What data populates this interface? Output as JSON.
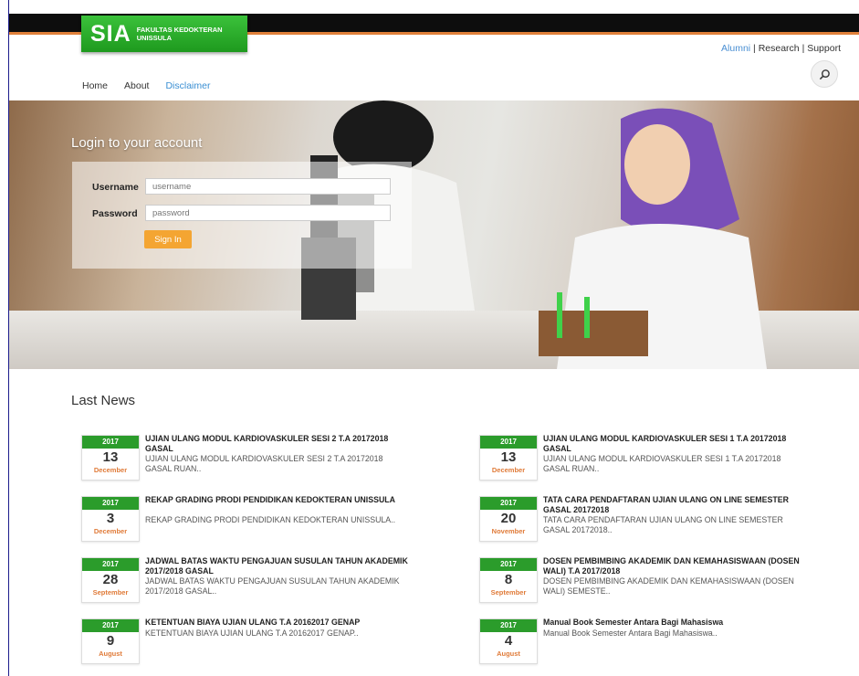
{
  "logo": {
    "main": "SIA",
    "sub_line1": "FAKULTAS KEDOKTERAN",
    "sub_line2": "UNISSULA"
  },
  "toplinks": {
    "alumni": "Alumni",
    "sep1": " | ",
    "research": "Research",
    "sep2": " | ",
    "support": "Support"
  },
  "nav": {
    "home": "Home",
    "about": "About",
    "disclaimer": "Disclaimer"
  },
  "login": {
    "title": "Login to your account",
    "username_label": "Username",
    "username_placeholder": "username",
    "password_label": "Password",
    "password_placeholder": "password",
    "signin_label": "Sign In"
  },
  "news": {
    "section_title": "Last News",
    "items": [
      {
        "year": "2017",
        "day": "13",
        "month": "December",
        "title": "UJIAN ULANG MODUL KARDIOVASKULER SESI 2 T.A 20172018 GASAL",
        "excerpt": "UJIAN ULANG MODUL KARDIOVASKULER SESI 2 T.A 20172018 GASAL RUAN.."
      },
      {
        "year": "2017",
        "day": "13",
        "month": "December",
        "title": "UJIAN ULANG MODUL KARDIOVASKULER SESI 1 T.A 20172018 GASAL",
        "excerpt": "UJIAN ULANG MODUL KARDIOVASKULER SESI 1 T.A 20172018 GASAL RUAN.."
      },
      {
        "year": "2017",
        "day": "3",
        "month": "December",
        "title": "REKAP GRADING PRODI PENDIDIKAN KEDOKTERAN UNISSULA",
        "excerpt": "REKAP GRADING PRODI PENDIDIKAN KEDOKTERAN UNISSULA.."
      },
      {
        "year": "2017",
        "day": "20",
        "month": "November",
        "title": "TATA CARA PENDAFTARAN UJIAN ULANG ON LINE SEMESTER GASAL 20172018",
        "excerpt": "TATA CARA PENDAFTARAN UJIAN ULANG ON LINE SEMESTER GASAL 20172018.."
      },
      {
        "year": "2017",
        "day": "28",
        "month": "September",
        "title": "JADWAL BATAS WAKTU PENGAJUAN SUSULAN TAHUN AKADEMIK 2017/2018 GASAL",
        "excerpt": "JADWAL BATAS WAKTU PENGAJUAN SUSULAN TAHUN AKADEMIK 2017/2018 GASAL.."
      },
      {
        "year": "2017",
        "day": "8",
        "month": "September",
        "title": "DOSEN PEMBIMBING AKADEMIK DAN KEMAHASISWAAN (DOSEN WALI) T.A 2017/2018",
        "excerpt": "DOSEN PEMBIMBING AKADEMIK DAN KEMAHASISWAAN (DOSEN WALI) SEMESTE.."
      },
      {
        "year": "2017",
        "day": "9",
        "month": "August",
        "title": "KETENTUAN BIAYA UJIAN ULANG T.A 20162017 GENAP",
        "excerpt": "KETENTUAN BIAYA UJIAN ULANG T.A 20162017 GENAP.."
      },
      {
        "year": "2017",
        "day": "4",
        "month": "August",
        "title": "Manual Book Semester Antara Bagi Mahasiswa",
        "excerpt": "Manual Book Semester Antara Bagi Mahasiswa.."
      }
    ]
  },
  "icons": {
    "search": "search-icon"
  },
  "colors": {
    "brand_green": "#2b9c2b",
    "accent_orange": "#e0803a",
    "link_blue": "#3a8fd3",
    "signin_orange": "#f4a532"
  }
}
